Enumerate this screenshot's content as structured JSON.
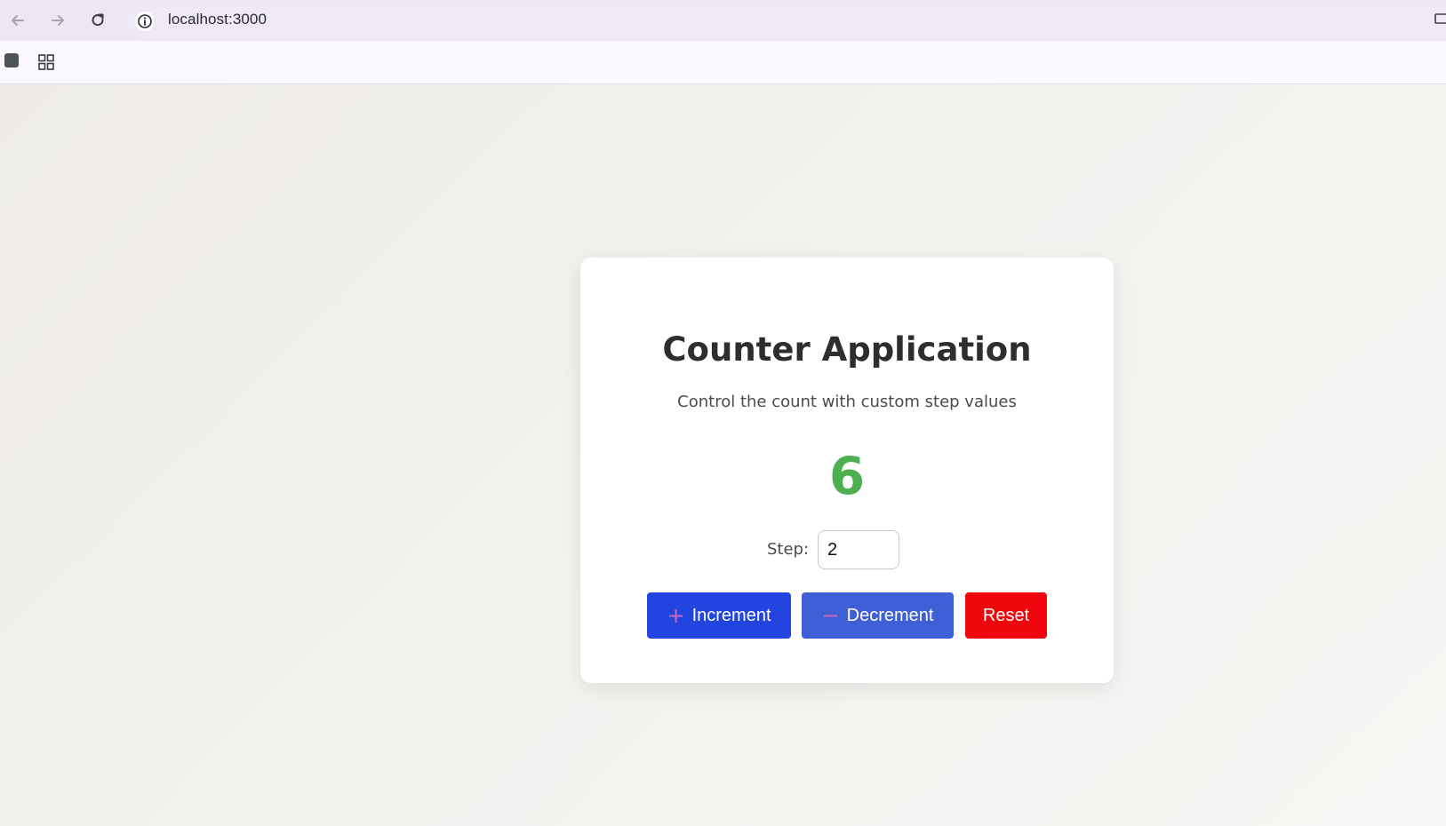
{
  "browser": {
    "url": "localhost:3000",
    "icons": [
      "back-arrow-icon",
      "forward-arrow-icon",
      "reload-icon",
      "site-info-icon",
      "cast-icon",
      "app-bookmark-icon",
      "apps-grid-icon"
    ]
  },
  "app": {
    "title": "Counter Application",
    "subtitle": "Control the count with custom step values",
    "count": "6",
    "step": {
      "label": "Step:",
      "value": "2"
    },
    "buttons": {
      "increment": {
        "icon": "plus-icon",
        "glyph": "+",
        "label": "Increment"
      },
      "decrement": {
        "icon": "minus-icon",
        "glyph": "−",
        "label": "Decrement"
      },
      "reset": {
        "label": "Reset"
      }
    }
  },
  "colors": {
    "count": "#4caf50",
    "increment_button": "#2344de",
    "decrement_button": "#3f5fd6",
    "reset_button": "#f0070d",
    "card_background": "#ffffff"
  }
}
